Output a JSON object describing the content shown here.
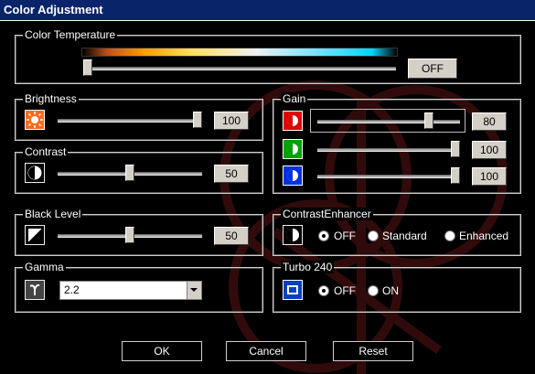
{
  "window": {
    "title": "Color Adjustment"
  },
  "color_temperature": {
    "label": "Color Temperature",
    "toggle_label": "OFF",
    "level": 0.0
  },
  "brightness": {
    "label": "Brightness",
    "value": "100",
    "level": 1.0,
    "icon": "brightness-sun-icon"
  },
  "contrast": {
    "label": "Contrast",
    "value": "50",
    "level": 0.5,
    "icon": "contrast-circle-icon"
  },
  "black_level": {
    "label": "Black Level",
    "value": "50",
    "level": 0.5,
    "icon": "black-level-icon"
  },
  "gamma": {
    "label": "Gamma",
    "selected": "2.2",
    "icon": "gamma-icon"
  },
  "gain": {
    "label": "Gain",
    "channels": [
      {
        "name": "red",
        "value": "80",
        "level": 0.8,
        "color": "#e00000"
      },
      {
        "name": "green",
        "value": "100",
        "level": 1.0,
        "color": "#00a000"
      },
      {
        "name": "blue",
        "value": "100",
        "level": 1.0,
        "color": "#0030e0"
      }
    ]
  },
  "contrast_enhancer": {
    "label": "ContrastEnhancer",
    "options": [
      "OFF",
      "Standard",
      "Enhanced"
    ],
    "selected": "OFF"
  },
  "turbo": {
    "label": "Turbo 240",
    "options": [
      "OFF",
      "ON"
    ],
    "selected": "OFF"
  },
  "buttons": {
    "ok": "OK",
    "cancel": "Cancel",
    "reset": "Reset"
  }
}
